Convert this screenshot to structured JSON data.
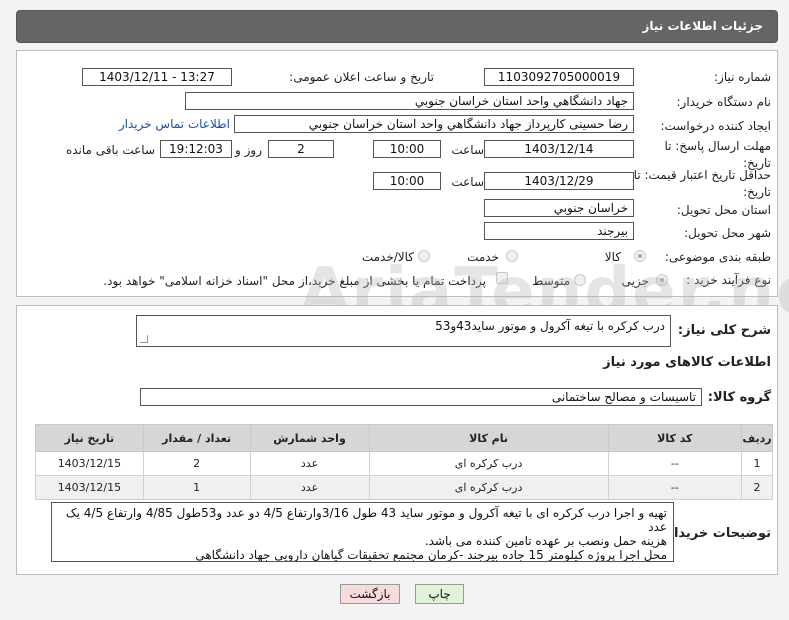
{
  "header": {
    "title": "جزئیات اطلاعات نیاز"
  },
  "fields": {
    "need_number_label": "شماره نیاز:",
    "need_number": "1103092705000019",
    "announce_label": "تاریخ و ساعت اعلان عمومی:",
    "announce_value": "1403/12/11 - 13:27",
    "buyer_org_label": "نام دستگاه خریدار:",
    "buyer_org": "جهاد دانشگاهي واحد استان خراسان جنوبي",
    "creator_label": "ایجاد کننده درخواست:",
    "creator": "رضا حسینی کارپرداز جهاد دانشگاهي واحد استان خراسان جنوبي",
    "contact_link": "اطلاعات تماس خریدار",
    "deadline_label": "مهلت ارسال پاسخ: تا تاریخ:",
    "deadline_date": "1403/12/14",
    "time_label": "ساعت",
    "deadline_time": "10:00",
    "days_value": "2",
    "days_label": "روز و",
    "remaining_time": "19:12:03",
    "remaining_label": "ساعت باقی مانده",
    "price_validity_label": "حداقل تاریخ اعتبار قیمت: تا تاریخ:",
    "price_validity_date": "1403/12/29",
    "price_validity_time": "10:00",
    "province_label": "استان محل تحویل:",
    "province": "خراسان جنوبي",
    "city_label": "شهر محل تحویل:",
    "city": "بیرجند",
    "category_label": "طبقه بندی موضوعی:",
    "category_options": [
      "کالا",
      "خدمت",
      "کالا/خدمت"
    ],
    "process_label": "نوع فرآیند خرید :",
    "process_options": [
      "جزیی",
      "متوسط"
    ],
    "payment_note": "پرداخت تمام یا بخشی از مبلغ خرید،از محل \"اسناد خزانه اسلامی\" خواهد بود."
  },
  "watermark": "AriaTender.neT",
  "summary": {
    "label": "شرح کلی نیاز:",
    "value": "درب کرکره با تیغه آکرول و موتور ساید43و53"
  },
  "goods": {
    "section_title": "اطلاعات کالاهای مورد نیاز",
    "group_label": "گروه کالا:",
    "group_value": "تاسیسات و مصالح ساختمانی",
    "columns": [
      "ردیف",
      "کد کالا",
      "نام کالا",
      "واحد شمارش",
      "تعداد / مقدار",
      "تاریخ نیاز"
    ],
    "rows": [
      [
        "1",
        "--",
        "درب کرکره ای",
        "عدد",
        "2",
        "1403/12/15"
      ],
      [
        "2",
        "--",
        "درب کرکره ای",
        "عدد",
        "1",
        "1403/12/15"
      ]
    ]
  },
  "buyer_notes": {
    "label": "توضیحات خریدار:",
    "lines": [
      "تهیه و اجرا  درب کرکره ای با تیغه آکرول و موتور ساید 43 طول 3/16وارتفاع 4/5 دو عدد و53طول 4/85 وارتفاع 4/5 یک عدد",
      "هزینه حمل ونصب بر عهده تامین کننده می باشد.",
      "محل اجرا پروژه کیلومتر 15 جاده بیرجند -کرمان مجتمع تحقیقات گیاهان دارویی جهاد دانشگاهی"
    ]
  },
  "buttons": {
    "print": "چاپ",
    "back": "بازگشت"
  },
  "colors": {
    "header_bg": "#656565",
    "print_btn": "#dff3d8",
    "back_btn": "#f8dcdc",
    "link": "#1a4fb0"
  }
}
